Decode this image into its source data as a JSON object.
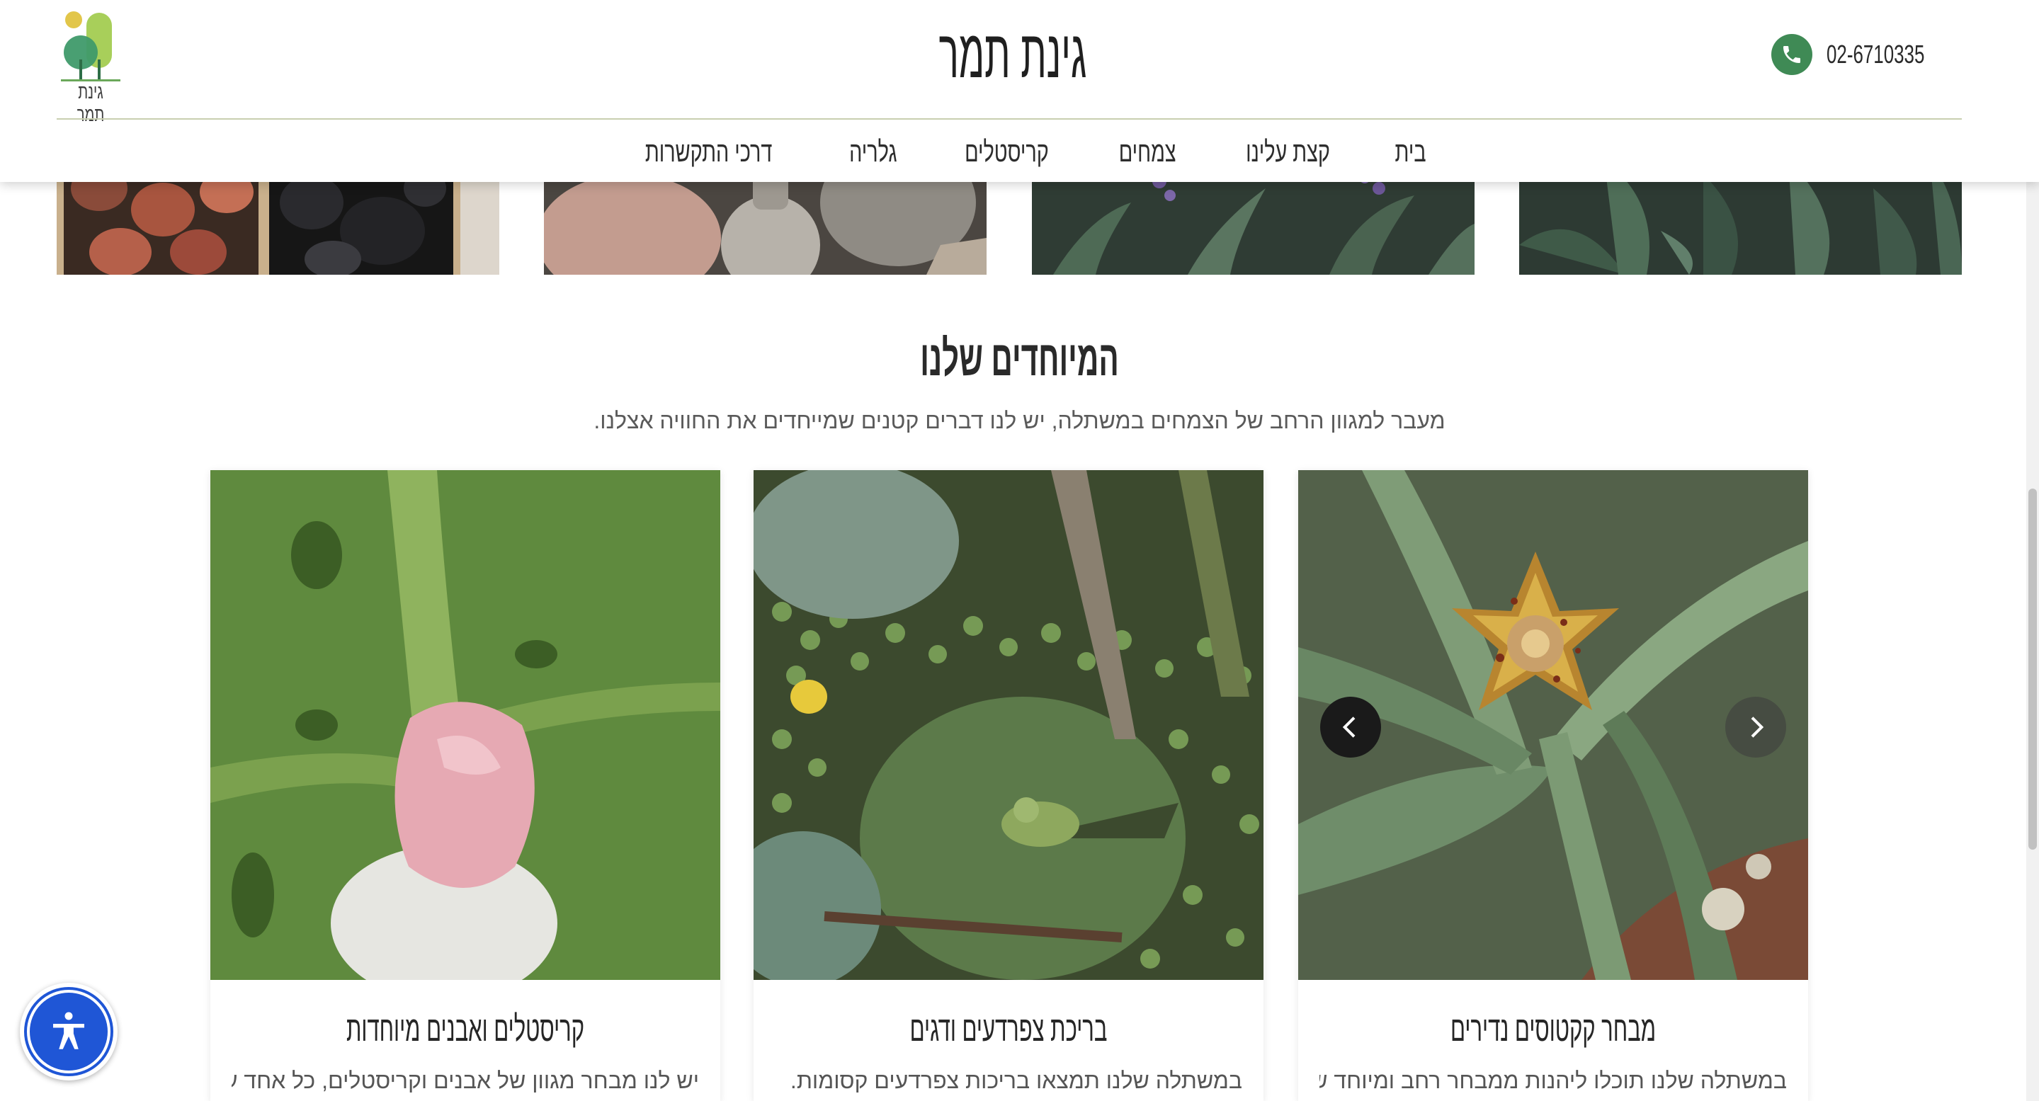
{
  "header": {
    "logo_text": "גינת תמר",
    "site_title": "גינת תמר",
    "phone_number": "02-6710335"
  },
  "nav": {
    "items": [
      {
        "label": "בית"
      },
      {
        "label": "קצת עלינו"
      },
      {
        "label": "צמחים"
      },
      {
        "label": "קריסטלים"
      },
      {
        "label": "גלריה"
      },
      {
        "label": "דרכי התקשרות"
      }
    ]
  },
  "section": {
    "title": "המיוחדים שלנו",
    "subtitle": "מעבר למגוון הרחב של הצמחים במשתלה, יש לנו דברים קטנים שמייחדים את החוויה אצלנו."
  },
  "cards": [
    {
      "title": "מבחר קקטוסים נדירים",
      "text": "במשתלה שלנו תוכלו ליהנות ממבחר רחב ומיוחד של"
    },
    {
      "title": "בריכת צפרדעים ודגים",
      "text": "במשתלה שלנו תמצאו בריכות צפרדעים קסומות."
    },
    {
      "title": "קריסטלים ואבנים מיוחדות",
      "text": "יש לנו מבחר מגוון של אבנים וקריסטלים, כל אחד עם"
    }
  ],
  "colors": {
    "brand_green": "#3f8a55",
    "accessibility_blue": "#1f56d6"
  },
  "icons": {
    "phone": "phone-icon",
    "prev": "chevron-left-icon",
    "next": "chevron-right-icon",
    "accessibility": "accessibility-icon"
  }
}
